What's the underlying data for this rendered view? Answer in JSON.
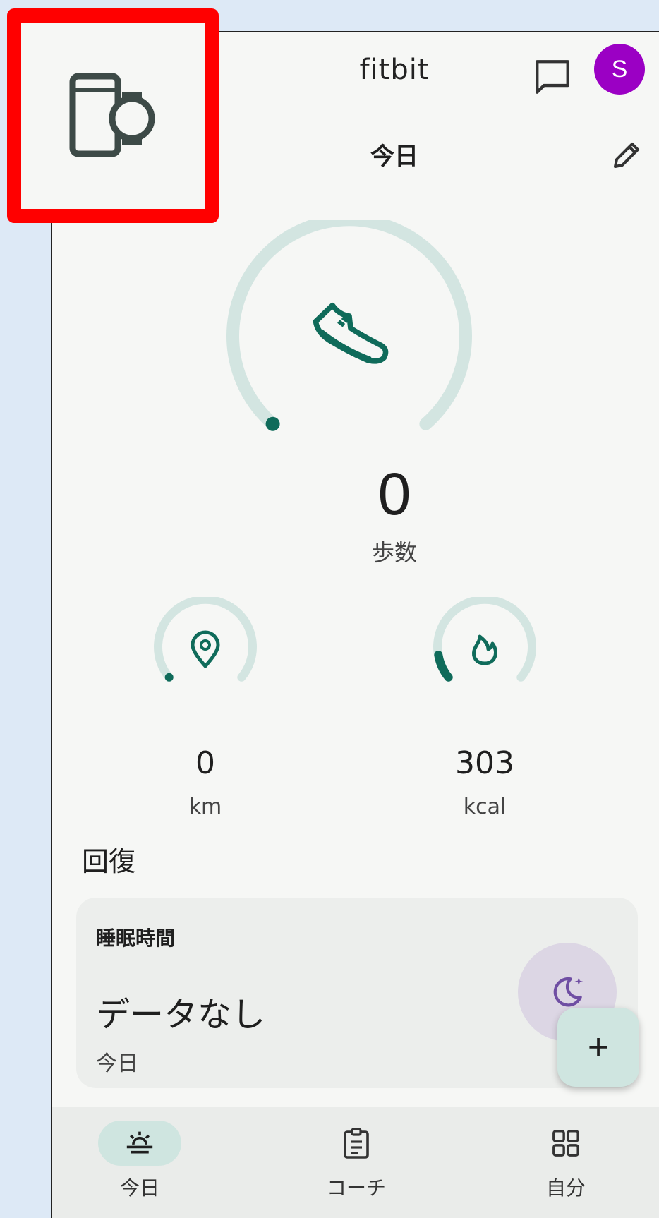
{
  "header": {
    "logo_text": "fitbit",
    "avatar_letter": "S"
  },
  "today": {
    "title": "今日"
  },
  "steps": {
    "value": "0",
    "label": "歩数",
    "progress": 0.0
  },
  "distance": {
    "value": "0",
    "unit": "km",
    "progress": 0.0
  },
  "calories": {
    "value": "303",
    "unit": "kcal",
    "progress": 0.12
  },
  "recovery": {
    "section_title": "回復",
    "sleep_card": {
      "title": "睡眠時間",
      "value": "データなし",
      "day": "今日"
    }
  },
  "fab": {
    "label": "+"
  },
  "nav": {
    "items": [
      {
        "label": "今日",
        "icon": "sunrise-icon",
        "active": true
      },
      {
        "label": "コーチ",
        "icon": "clipboard-icon",
        "active": false
      },
      {
        "label": "自分",
        "icon": "grid-icon",
        "active": false
      }
    ]
  },
  "colors": {
    "accent": "#0f6b5a",
    "ring_track": "#d3e5e1",
    "highlight": "#ff0000",
    "avatar": "#9b00c4"
  }
}
